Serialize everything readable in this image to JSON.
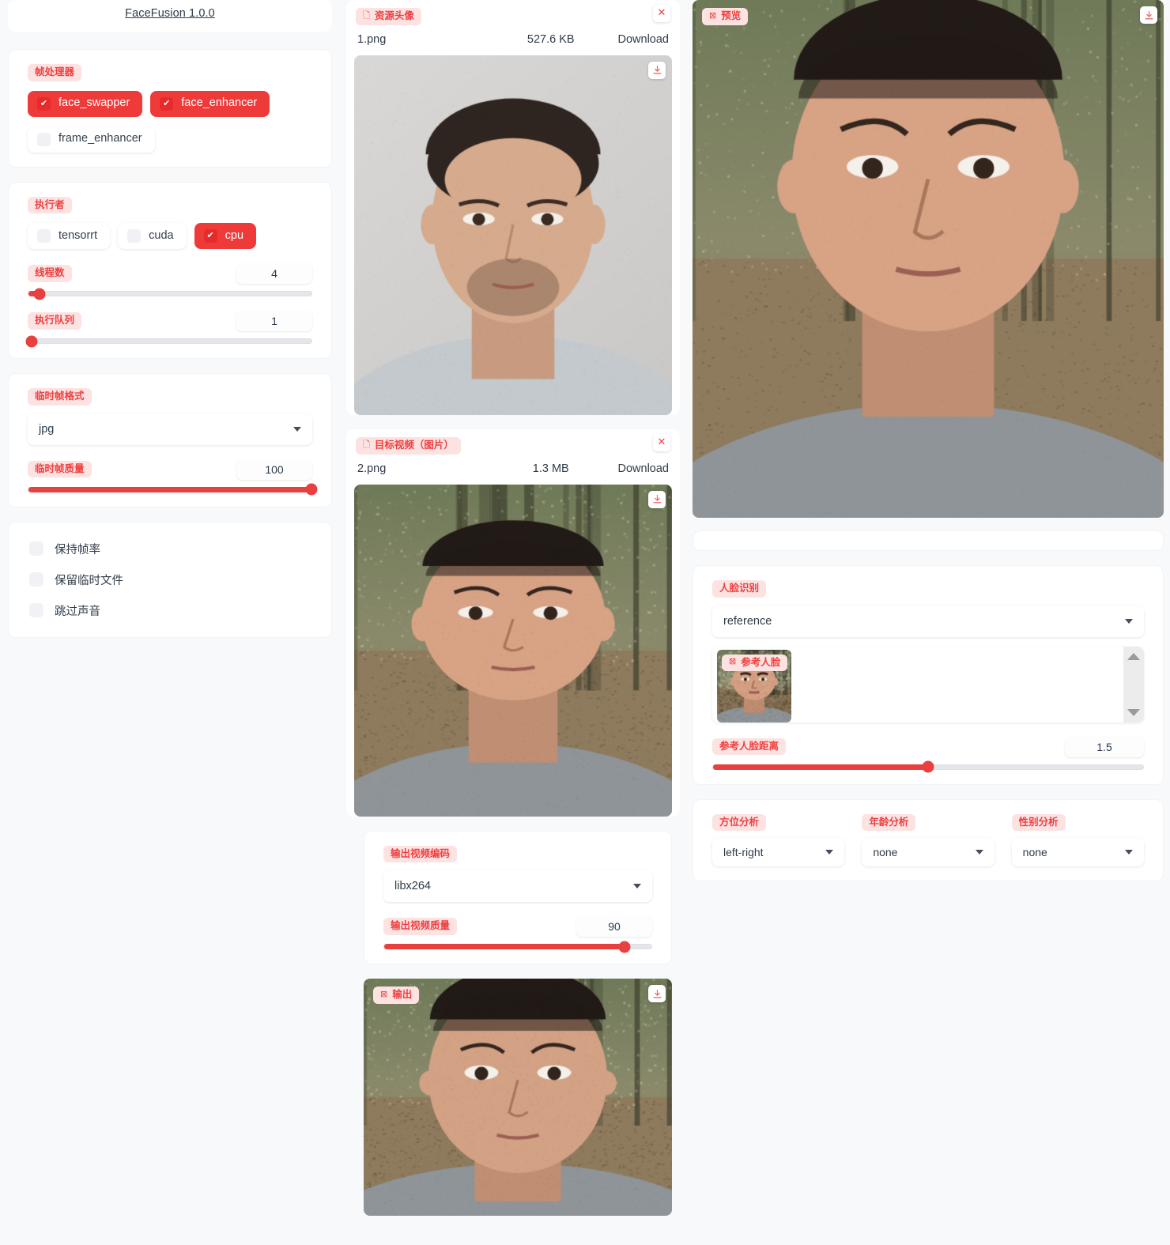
{
  "app": {
    "title": "FaceFusion 1.0.0"
  },
  "frame_processors": {
    "label": "帧处理器",
    "options": [
      {
        "name": "face_swapper",
        "checked": true
      },
      {
        "name": "face_enhancer",
        "checked": true
      },
      {
        "name": "frame_enhancer",
        "checked": false
      }
    ]
  },
  "execution": {
    "label": "执行者",
    "options": [
      {
        "name": "tensorrt",
        "checked": false
      },
      {
        "name": "cuda",
        "checked": false
      },
      {
        "name": "cpu",
        "checked": true
      }
    ],
    "thread_count": {
      "label": "线程数",
      "value": "4",
      "percent": 4
    },
    "queue_count": {
      "label": "执行队列",
      "value": "1",
      "percent": 1
    }
  },
  "temp_frame": {
    "format_label": "临时帧格式",
    "format_value": "jpg",
    "quality_label": "临时帧质量",
    "quality_value": "100",
    "quality_percent": 100
  },
  "options": {
    "items": [
      {
        "label": "保持帧率",
        "checked": false
      },
      {
        "label": "保留临时文件",
        "checked": false
      },
      {
        "label": "跳过声音",
        "checked": false
      }
    ]
  },
  "source": {
    "label": "资源头像",
    "icon": "file-icon",
    "file_name": "1.png",
    "file_size": "527.6 KB",
    "download_label": "Download",
    "close_icon": "close-icon"
  },
  "target": {
    "label": "目标视频（图片）",
    "icon": "file-icon",
    "file_name": "2.png",
    "file_size": "1.3 MB",
    "download_label": "Download",
    "close_icon": "close-icon"
  },
  "output_video": {
    "encoder_label": "输出视频编码",
    "encoder_value": "libx264",
    "quality_label": "输出视频质量",
    "quality_value": "90",
    "quality_percent": 90
  },
  "output_preview": {
    "label": "输出",
    "icon": "image-icon"
  },
  "preview": {
    "label": "预览",
    "icon": "image-icon"
  },
  "face_recognition": {
    "label": "人脸识别",
    "mode_value": "reference",
    "reference_face": {
      "label": "参考人脸",
      "icon": "image-icon"
    },
    "distance": {
      "label": "参考人脸距离",
      "value": "1.5",
      "percent": 50
    }
  },
  "analysis": {
    "direction": {
      "label": "方位分析",
      "value": "left-right"
    },
    "age": {
      "label": "年龄分析",
      "value": "none"
    },
    "gender": {
      "label": "性别分析",
      "value": "none"
    }
  },
  "colors": {
    "accent": "#ef3a3a",
    "chip_bg": "#fde2e2",
    "page_bg": "#f7f9fb",
    "panel_bg": "#ffffff"
  }
}
